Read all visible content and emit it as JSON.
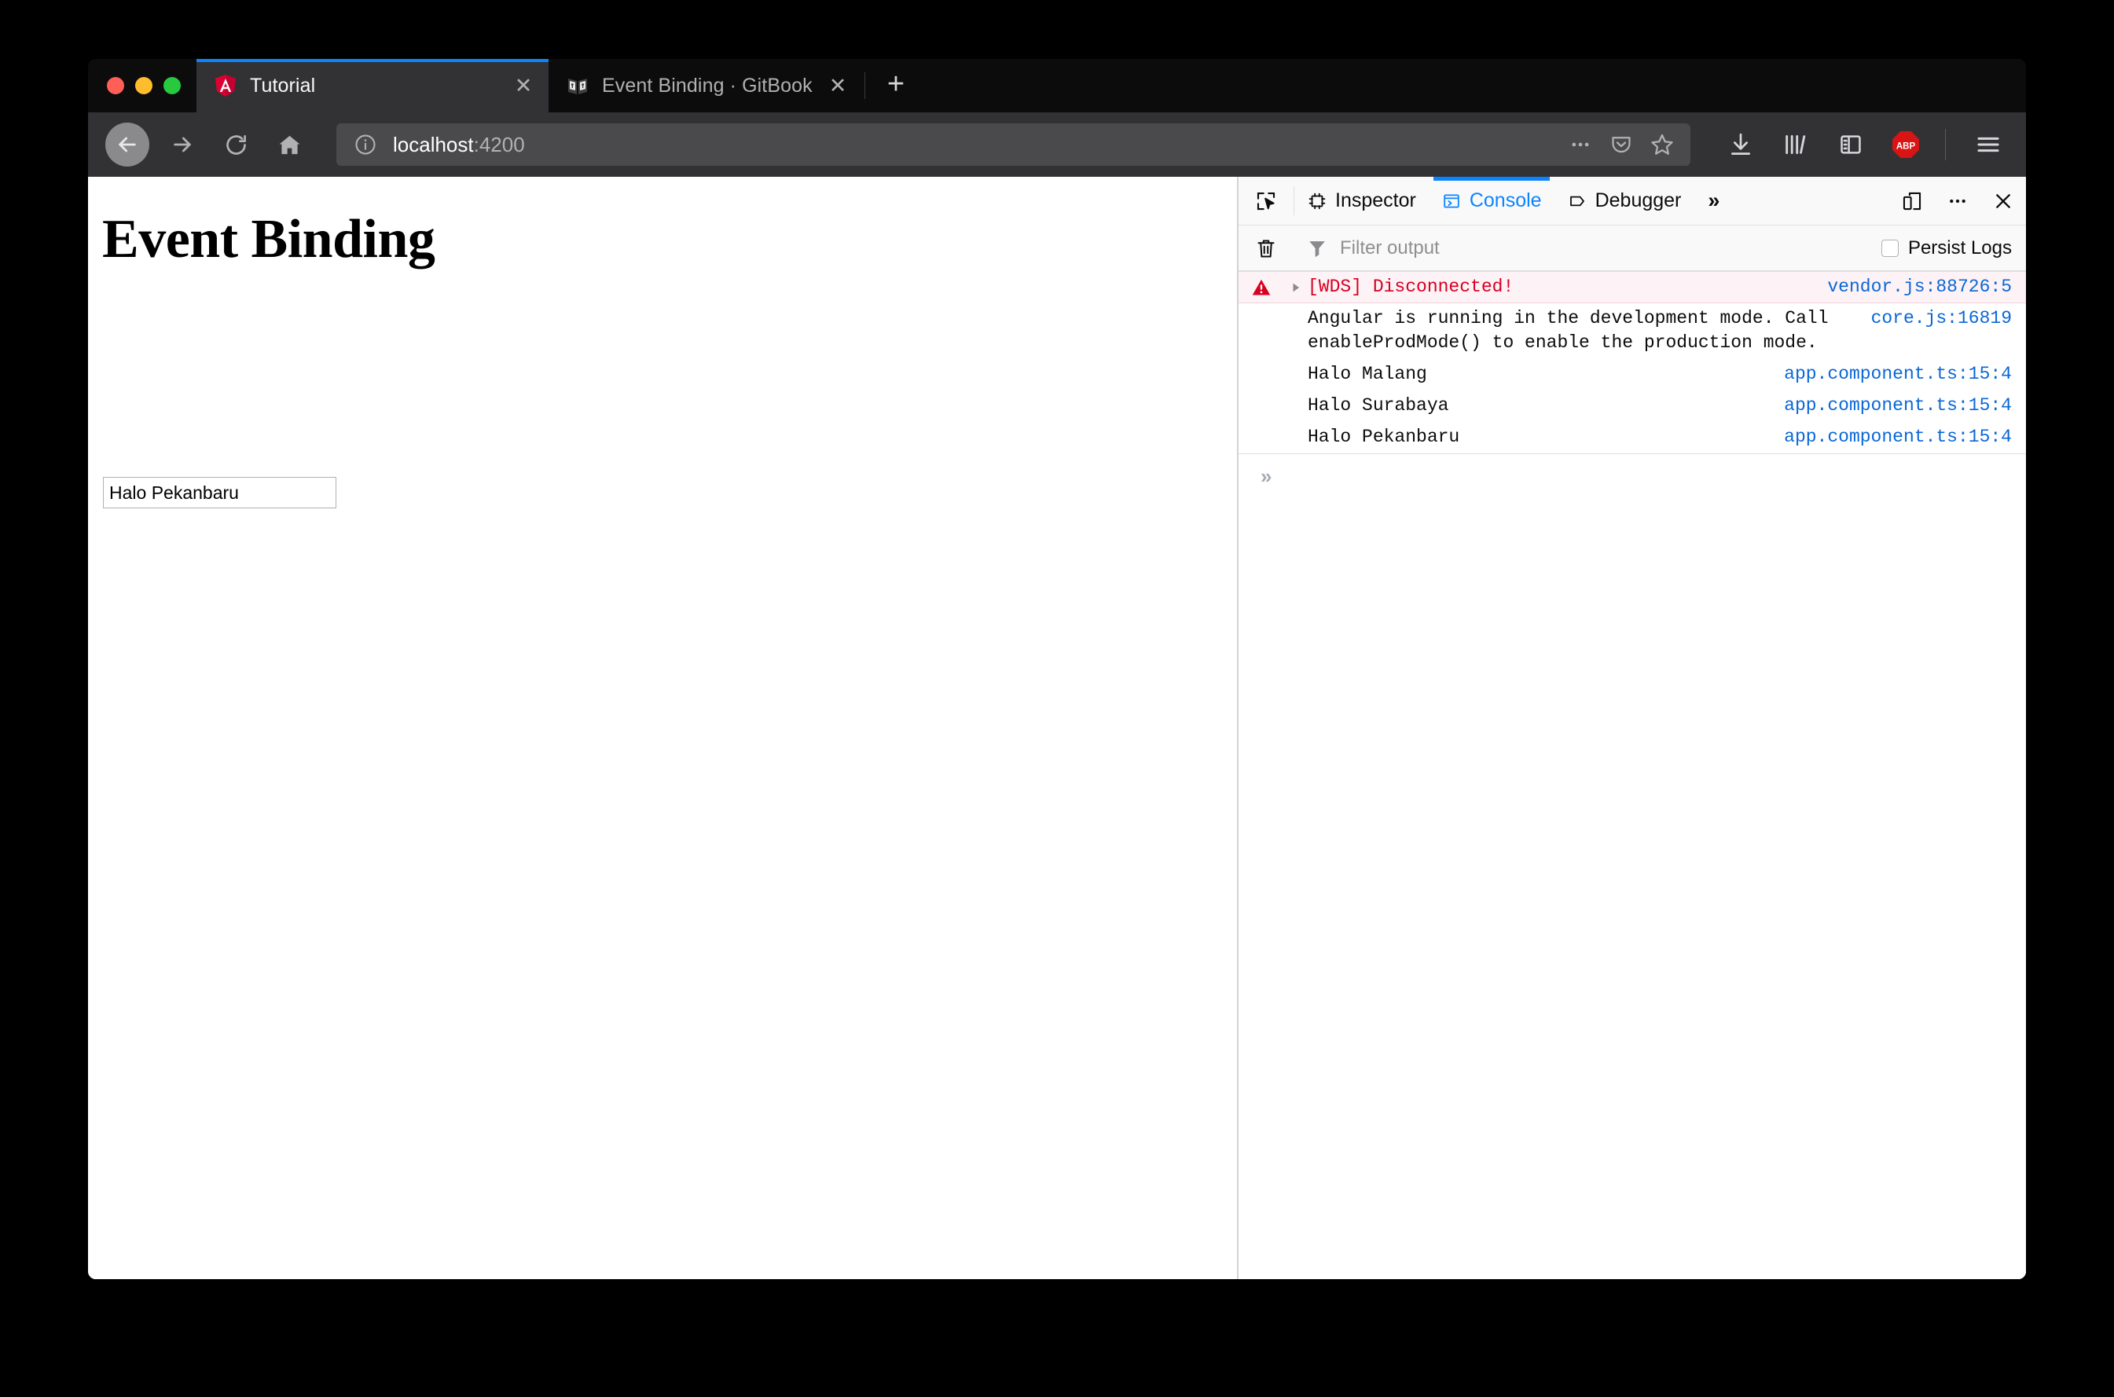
{
  "window": {
    "traffic_lights": [
      "close",
      "minimize",
      "maximize"
    ]
  },
  "tabs": [
    {
      "title": "Tutorial",
      "favicon": "angular-icon",
      "active": true,
      "close_label": "✕"
    },
    {
      "title": "Event Binding · GitBook",
      "favicon": "gitbook-icon",
      "active": false,
      "close_label": "✕"
    }
  ],
  "new_tab_label": "+",
  "navigation": {
    "back_icon": "back-arrow-icon",
    "forward_icon": "forward-arrow-icon",
    "reload_icon": "reload-icon",
    "home_icon": "home-icon"
  },
  "url_bar": {
    "info_icon": "info-circle-icon",
    "host": "localhost",
    "port": ":4200",
    "page_actions_icon": "ellipsis-icon",
    "pocket_icon": "pocket-icon",
    "bookmark_icon": "star-icon"
  },
  "toolbar": {
    "downloads_icon": "download-icon",
    "library_icon": "library-icon",
    "sidebar_icon": "sidebar-icon",
    "adblock_label": "ABP",
    "menu_icon": "hamburger-menu-icon"
  },
  "page": {
    "heading": "Event Binding",
    "input_value": "Halo Pekanbaru",
    "input_placeholder": ""
  },
  "devtools": {
    "picker_icon": "element-picker-icon",
    "tabs": [
      {
        "label": "Inspector",
        "icon": "inspector-icon",
        "selected": false
      },
      {
        "label": "Console",
        "icon": "console-icon",
        "selected": true
      },
      {
        "label": "Debugger",
        "icon": "debugger-icon",
        "selected": false
      }
    ],
    "overflow_label": "»",
    "responsive_mode_icon": "responsive-design-mode-icon",
    "meatball_icon": "ellipsis-icon",
    "close_icon": "close-icon",
    "console_toolbar": {
      "clear_icon": "trash-icon",
      "filter_icon": "funnel-icon",
      "filter_placeholder": "Filter output",
      "filter_value": "",
      "persist_logs_label": "Persist Logs",
      "persist_logs_checked": false
    },
    "messages": [
      {
        "level": "error",
        "has_expander": true,
        "text": "[WDS] Disconnected!",
        "source": "vendor.js:88726:5"
      },
      {
        "level": "log",
        "has_expander": false,
        "text": "Angular is running in the development mode. Call enableProdMode() to enable the production mode.",
        "source": "core.js:16819"
      },
      {
        "level": "log",
        "has_expander": false,
        "text": "Halo Malang",
        "source": "app.component.ts:15:4"
      },
      {
        "level": "log",
        "has_expander": false,
        "text": "Halo Surabaya",
        "source": "app.component.ts:15:4"
      },
      {
        "level": "log",
        "has_expander": false,
        "text": "Halo Pekanbaru",
        "source": "app.component.ts:15:4"
      }
    ],
    "console_input": {
      "prompt": "»",
      "value": ""
    }
  },
  "colors": {
    "accent_blue": "#0a84ff",
    "error_red": "#d70022",
    "source_link": "#0a67d6",
    "chrome_dark": "#0c0c0d",
    "toolbar_gray": "#323234"
  }
}
